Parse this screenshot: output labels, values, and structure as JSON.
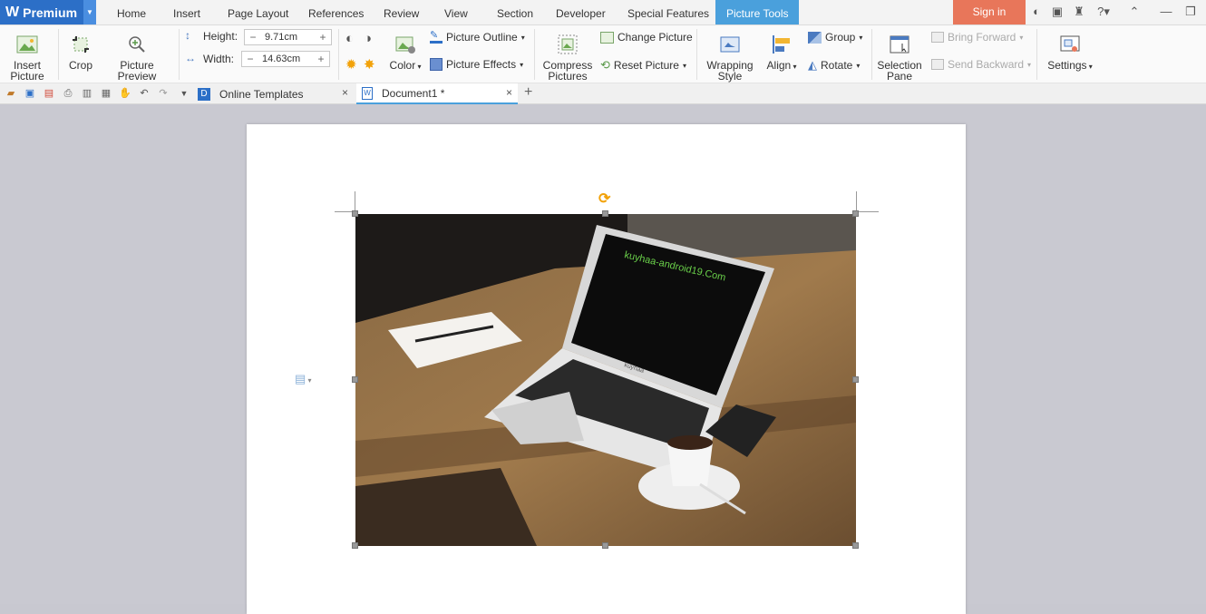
{
  "app": {
    "brand": "Premium"
  },
  "menu": {
    "tabs": [
      "Home",
      "Insert",
      "Page Layout",
      "References",
      "Review",
      "View",
      "Section",
      "Developer",
      "Special Features"
    ],
    "active_tab": "Picture Tools",
    "sign_in": "Sign in"
  },
  "ribbon": {
    "insert_picture": "Insert Picture",
    "crop": "Crop",
    "picture_preview": "Picture Preview",
    "height_label": "Height:",
    "height_value": "9.71cm",
    "width_label": "Width:",
    "width_value": "14.63cm",
    "color": "Color",
    "picture_outline": "Picture Outline",
    "picture_effects": "Picture Effects",
    "compress_pictures": "Compress Pictures",
    "change_picture": "Change Picture",
    "reset_picture": "Reset Picture",
    "wrapping_style": "Wrapping Style",
    "align": "Align",
    "group": "Group",
    "rotate": "Rotate",
    "selection_pane": "Selection Pane",
    "bring_forward": "Bring Forward",
    "send_backward": "Send Backward",
    "settings": "Settings"
  },
  "quickbar": {
    "tabs": [
      {
        "label": "Online Templates"
      },
      {
        "label": "Document1 *"
      }
    ]
  },
  "document": {
    "photo_watermark": "kuyhaa-android19.Com",
    "laptop_brand": "kuyhaa"
  },
  "colors": {
    "brand_blue": "#2c6fc7",
    "picture_tools_tab": "#4aa0dc",
    "sign_in_bg": "#e8765a"
  }
}
